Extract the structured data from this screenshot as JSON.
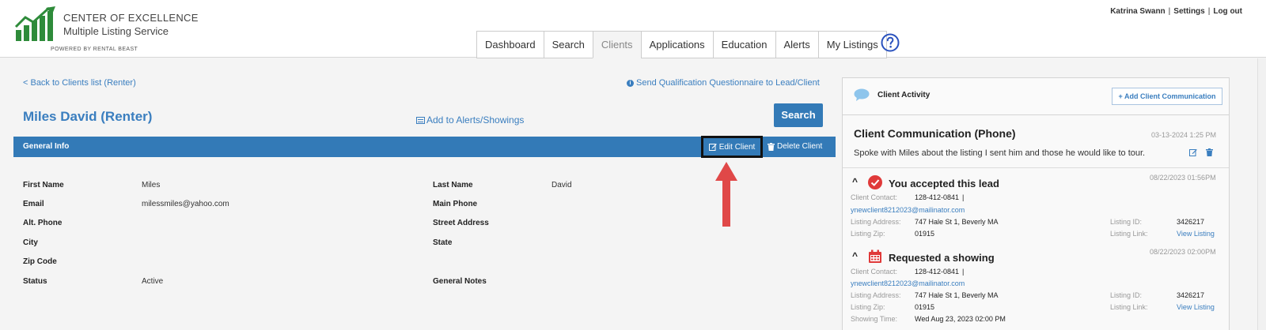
{
  "brand": {
    "line1": "CENTER OF  EXCELLENCE",
    "line2": "Multiple Listing  Service",
    "line3": "POWERED BY RENTAL BEAST",
    "accent": "#2e8b3a"
  },
  "user_links": {
    "name": "Katrina Swann",
    "settings": "Settings",
    "logout": "Log out",
    "sep": "|"
  },
  "nav": {
    "tabs": [
      {
        "label": "Dashboard",
        "active": false
      },
      {
        "label": "Search",
        "active": false
      },
      {
        "label": "Clients",
        "active": true
      },
      {
        "label": "Applications",
        "active": false
      },
      {
        "label": "Education",
        "active": false
      },
      {
        "label": "Alerts",
        "active": false
      },
      {
        "label": "My Listings",
        "active": false
      }
    ],
    "help_icon": "question-circle-icon"
  },
  "links": {
    "back": "< Back to Clients list (Renter)",
    "questionnaire": "Send Qualification Questionnaire to Lead/Client",
    "add_alerts": "Add to Alerts/Showings"
  },
  "page_title": "Miles David (Renter)",
  "search_button": "Search",
  "general_info": {
    "title": "General Info",
    "edit": "Edit Client",
    "delete": "Delete Client"
  },
  "fields": {
    "first_name": {
      "label": "First Name",
      "value": "Miles"
    },
    "last_name": {
      "label": "Last Name",
      "value": "David"
    },
    "email": {
      "label": "Email",
      "value": "milessmiles@yahoo.com"
    },
    "main_phone": {
      "label": "Main Phone",
      "value": ""
    },
    "alt_phone": {
      "label": "Alt. Phone",
      "value": ""
    },
    "street": {
      "label": "Street Address",
      "value": ""
    },
    "city": {
      "label": "City",
      "value": ""
    },
    "state": {
      "label": "State",
      "value": ""
    },
    "zip": {
      "label": "Zip Code",
      "value": ""
    },
    "status": {
      "label": "Status",
      "value": "Active"
    },
    "notes": {
      "label": "General Notes",
      "value": ""
    }
  },
  "activity": {
    "title": "Client Activity",
    "add_button": "+ Add Client Communication",
    "communication": {
      "title": "Client Communication (Phone)",
      "date": "03-13-2024 1:25 PM",
      "text": "Spoke with Miles about the listing I sent him and those he would like to tour."
    },
    "items": [
      {
        "title": "You accepted this lead",
        "date": "08/22/2023 01:56PM",
        "contact_label": "Client Contact:",
        "contact_phone": "128-412-0841",
        "contact_sep": "|",
        "email": "ynewclient8212023@mailinator.com",
        "address_label": "Listing Address:",
        "address": "747 Hale St 1, Beverly MA",
        "zip_label": "Listing Zip:",
        "zip": "01915",
        "id_label": "Listing ID:",
        "id": "3426217",
        "link_label": "Listing Link:",
        "link": "View Listing"
      },
      {
        "title": "Requested a showing",
        "date": "08/22/2023 02:00PM",
        "contact_label": "Client Contact:",
        "contact_phone": "128-412-0841",
        "contact_sep": "|",
        "email": "ynewclient8212023@mailinator.com",
        "address_label": "Listing Address:",
        "address": "747 Hale St 1, Beverly MA",
        "zip_label": "Listing Zip:",
        "zip": "01915",
        "id_label": "Listing ID:",
        "id": "3426217",
        "link_label": "Listing Link:",
        "link": "View Listing",
        "time_label": "Showing Time:",
        "time": "Wed Aug 23, 2023 02:00 PM"
      }
    ]
  },
  "colors": {
    "primary": "#337ab7",
    "link": "#3a7ebf",
    "arrow": "#e04848",
    "check": "#e03a3a"
  }
}
